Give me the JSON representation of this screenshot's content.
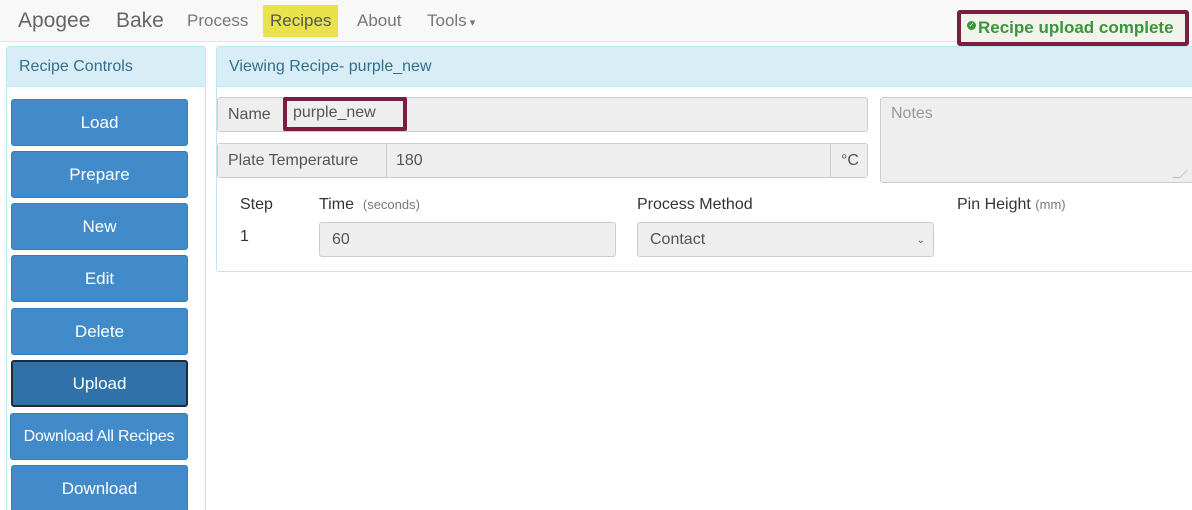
{
  "navbar": {
    "brand_first": "Apogee",
    "brand_second": "Bake",
    "items": [
      {
        "label": "Process"
      },
      {
        "label": "Recipes",
        "active": true
      },
      {
        "label": "About"
      },
      {
        "label": "Tools",
        "has_dropdown": true
      }
    ],
    "status_text": "Recipe upload complete",
    "status_icon": "check-circle-icon",
    "status_color": "#3a963a",
    "highlight_color": "#7b1d43",
    "active_tab_color": "#e9e24a"
  },
  "sidebar": {
    "title": "Recipe Controls",
    "buttons": [
      {
        "label": "Load"
      },
      {
        "label": "Prepare"
      },
      {
        "label": "New"
      },
      {
        "label": "Edit"
      },
      {
        "label": "Delete"
      },
      {
        "label": "Upload",
        "active": true
      },
      {
        "label": "Download All Recipes"
      },
      {
        "label": "Download"
      }
    ],
    "button_color": "#428bca"
  },
  "recipe": {
    "panel_title": "Viewing Recipe- purple_new",
    "name_label": "Name",
    "name_value": "purple_new",
    "plate_temp_label": "Plate Temperature",
    "plate_temp_value": "180",
    "plate_temp_unit": "°C",
    "notes_placeholder": "Notes",
    "steps_table": {
      "step_label": "Step",
      "time_label": "Time",
      "time_unit": "(seconds)",
      "method_label": "Process Method",
      "pin_label": "Pin Height",
      "pin_unit": "(mm)",
      "rows": [
        {
          "step": "1",
          "time": "60",
          "method": "Contact"
        }
      ]
    }
  }
}
